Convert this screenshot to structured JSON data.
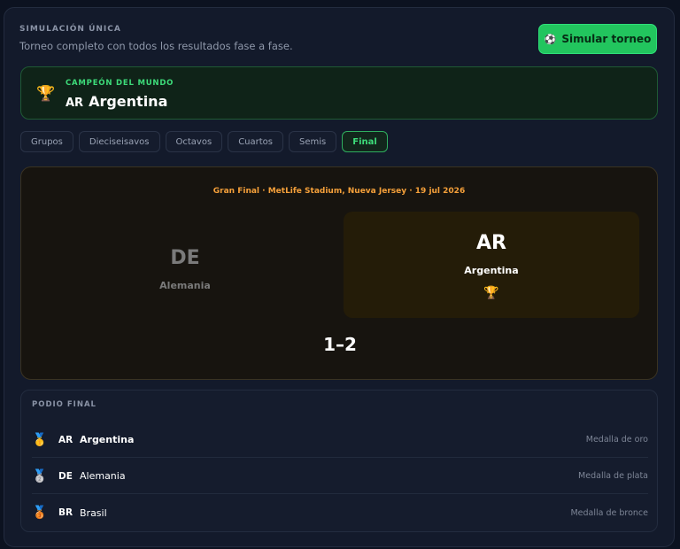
{
  "header": {
    "label": "SIMULACIÓN ÚNICA",
    "subtitle": "Torneo completo con todos los resultados fase a fase.",
    "button_label": "Simular torneo",
    "button_icon": "soccer-ball-icon"
  },
  "champion": {
    "label": "CAMPEÓN DEL MUNDO",
    "code": "AR",
    "name": "Argentina"
  },
  "tabs": [
    {
      "label": "Grupos"
    },
    {
      "label": "Dieciseisavos"
    },
    {
      "label": "Octavos"
    },
    {
      "label": "Cuartos"
    },
    {
      "label": "Semis"
    },
    {
      "label": "Final",
      "active": true
    }
  ],
  "final": {
    "info": "Gran Final · MetLife Stadium, Nueva Jersey · 19 jul 2026",
    "loser": {
      "code": "DE",
      "name": "Alemania"
    },
    "winner": {
      "code": "AR",
      "name": "Argentina"
    },
    "score": "1–2"
  },
  "podium": {
    "label": "PODIO FINAL",
    "rows": [
      {
        "code": "AR",
        "name": "Argentina",
        "medal": "Medalla de oro",
        "icon": "gold-medal-icon"
      },
      {
        "code": "DE",
        "name": "Alemania",
        "medal": "Medalla de plata",
        "icon": "silver-medal-icon"
      },
      {
        "code": "BR",
        "name": "Brasil",
        "medal": "Medalla de bronce",
        "icon": "bronze-medal-icon"
      }
    ]
  },
  "colors": {
    "accent_green": "#22c55e",
    "final_orange": "#f5a03a",
    "background": "#131a2b"
  }
}
